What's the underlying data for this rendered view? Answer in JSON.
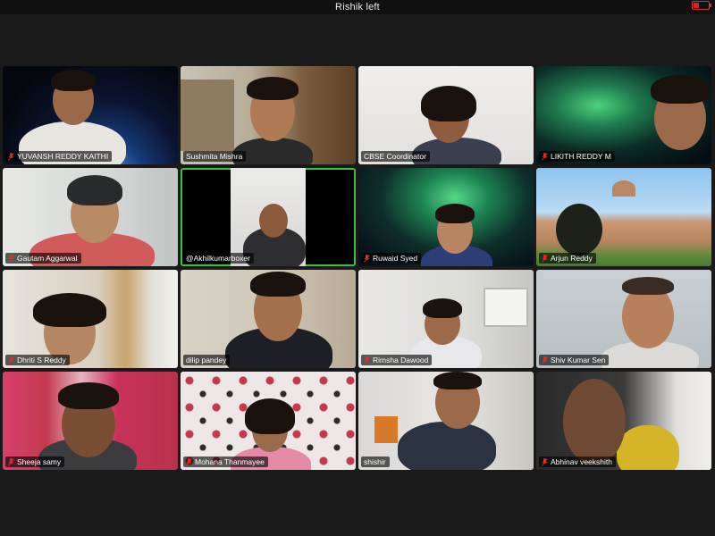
{
  "window": {
    "title": "Rishik left",
    "left_info": "",
    "battery_level": 0.35
  },
  "colors": {
    "active_speaker": "#3fbf3f",
    "muted_icon": "#e02b2b",
    "background": "#1a1a1a"
  },
  "participants": [
    {
      "name": "YUVANSH REDDY KAITHI",
      "muted": true
    },
    {
      "name": "Sushmita Mishra",
      "muted": false
    },
    {
      "name": "CBSE Coordinator",
      "muted": false
    },
    {
      "name": "LIKITH REDDY M",
      "muted": true
    },
    {
      "name": "Gautam Aggarwal",
      "muted": true
    },
    {
      "name": "@Akhilkumarboxer",
      "muted": false,
      "active_speaker": true
    },
    {
      "name": "Ruwaid Syed",
      "muted": true
    },
    {
      "name": "Arjun Reddy",
      "muted": true
    },
    {
      "name": "Dhriti S Reddy",
      "muted": true
    },
    {
      "name": "dilip pandey",
      "muted": false
    },
    {
      "name": "Rimsha Dawood",
      "muted": true
    },
    {
      "name": "Shiv Kumar Sen",
      "muted": true
    },
    {
      "name": "Sheeja samy",
      "muted": true
    },
    {
      "name": "Mohana Thanmayee",
      "muted": true
    },
    {
      "name": "shishir",
      "muted": false
    },
    {
      "name": "Abhinav veekshith",
      "muted": true
    }
  ]
}
